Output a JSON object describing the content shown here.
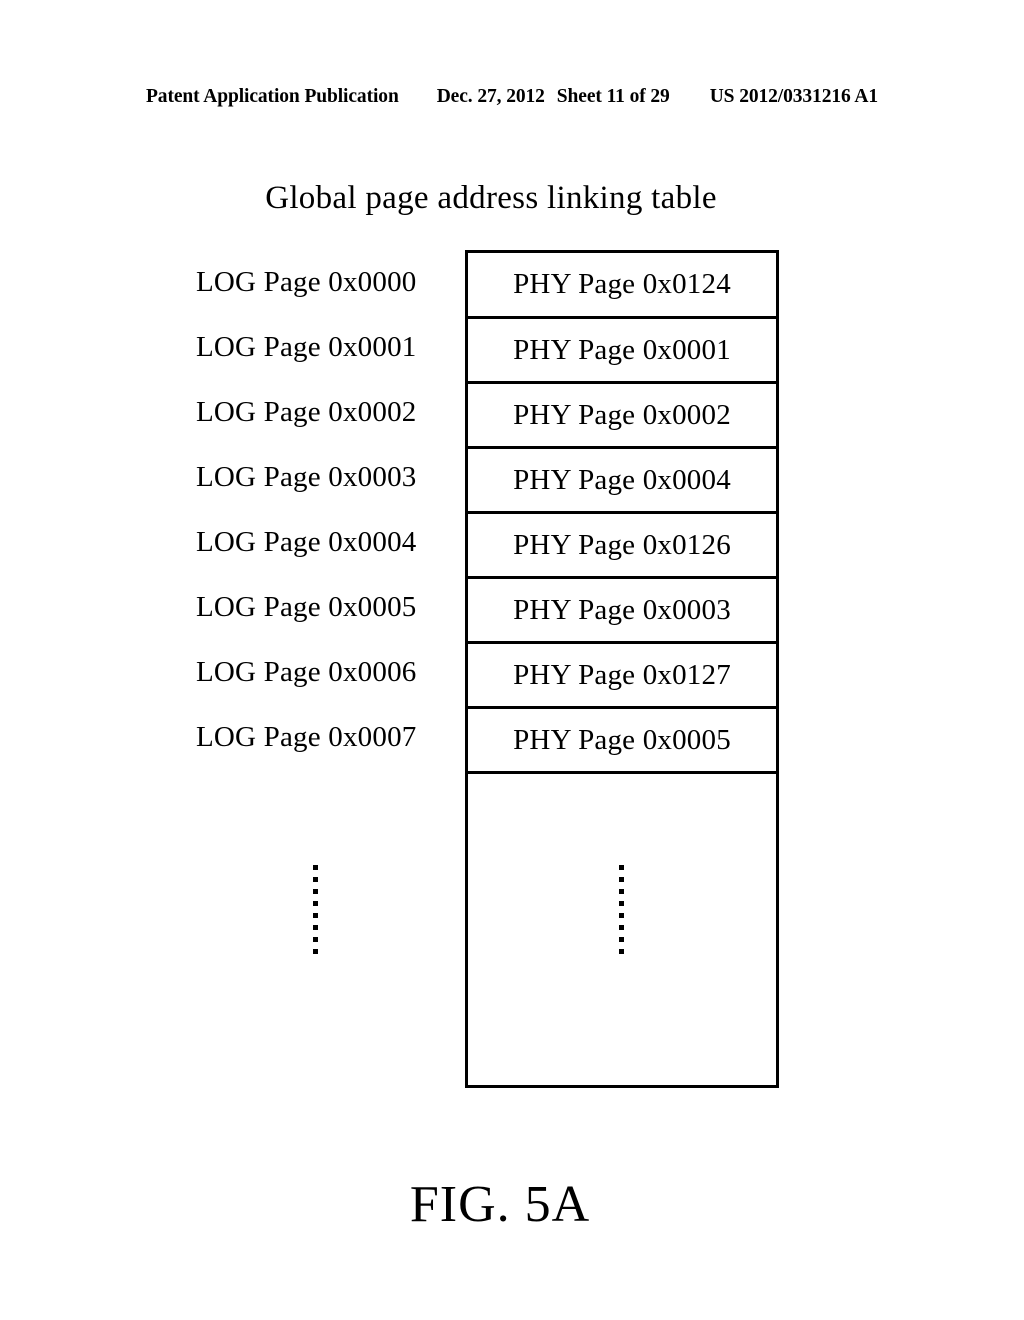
{
  "header": {
    "publication": "Patent Application Publication",
    "date": "Dec. 27, 2012",
    "sheet": "Sheet 11 of 29",
    "patent_number": "US 2012/0331216 A1"
  },
  "figure": {
    "title": "Global page address linking table",
    "caption": "FIG. 5A"
  },
  "table": {
    "rows": [
      {
        "logical": "LOG Page 0x0000",
        "physical": "PHY Page 0x0124"
      },
      {
        "logical": "LOG Page 0x0001",
        "physical": "PHY Page 0x0001"
      },
      {
        "logical": "LOG Page 0x0002",
        "physical": "PHY Page 0x0002"
      },
      {
        "logical": "LOG Page 0x0003",
        "physical": "PHY Page 0x0004"
      },
      {
        "logical": "LOG Page 0x0004",
        "physical": "PHY Page 0x0126"
      },
      {
        "logical": "LOG Page 0x0005",
        "physical": "PHY Page 0x0003"
      },
      {
        "logical": "LOG Page 0x0006",
        "physical": "PHY Page 0x0127"
      },
      {
        "logical": "LOG Page 0x0007",
        "physical": "PHY Page 0x0005"
      }
    ],
    "continuation_dots": 8
  },
  "colors": {
    "ink": "#000000",
    "paper": "#ffffff"
  }
}
